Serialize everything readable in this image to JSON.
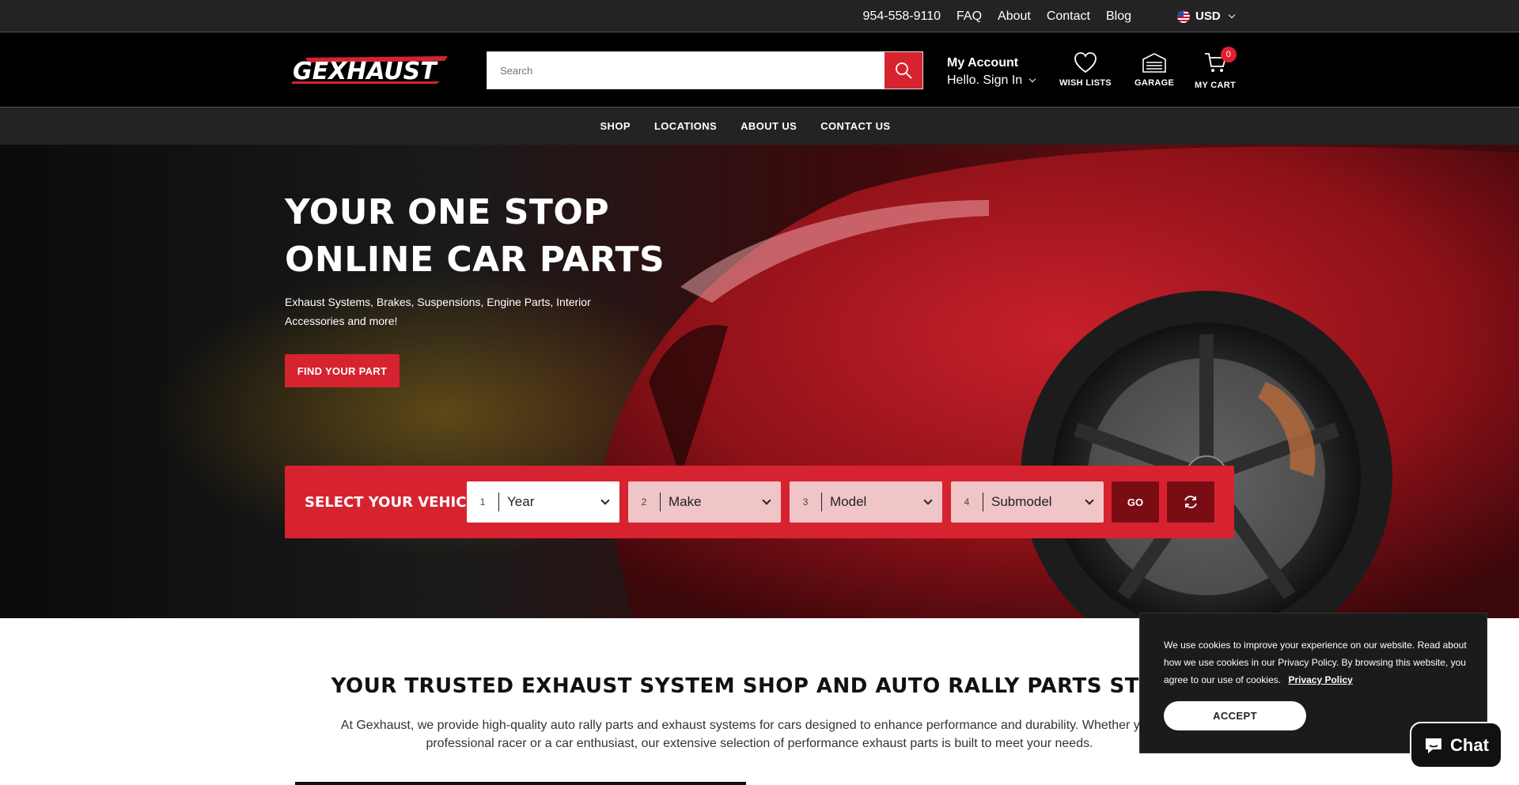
{
  "topbar": {
    "links": [
      "954-558-9110",
      "FAQ",
      "About",
      "Contact",
      "Blog"
    ],
    "currency": "USD"
  },
  "header": {
    "logo_text": "GEXHAUST",
    "search_placeholder": "Search",
    "account_title": "My Account",
    "account_sub": "Hello. Sign In",
    "wishlist_label": "WISH LISTS",
    "garage_label": "GARAGE",
    "cart_label": "MY CART",
    "cart_count": "0"
  },
  "nav": {
    "items": [
      "SHOP",
      "LOCATIONS",
      "ABOUT US",
      "CONTACT US"
    ]
  },
  "hero": {
    "title_line1": "YOUR ONE STOP",
    "title_line2": "ONLINE CAR PARTS",
    "subtitle": "Exhaust Systems, Brakes, Suspensions, Engine Parts, Interior Accessories and more!",
    "cta": "FIND YOUR PART"
  },
  "vehicle": {
    "title": "SELECT YOUR VEHICLE",
    "selects": [
      {
        "num": "1",
        "label": "Year"
      },
      {
        "num": "2",
        "label": "Make"
      },
      {
        "num": "3",
        "label": "Model"
      },
      {
        "num": "4",
        "label": "Submodel"
      }
    ],
    "go_label": "GO"
  },
  "intro": {
    "title": "YOUR TRUSTED EXHAUST SYSTEM SHOP AND AUTO RALLY PARTS STORE",
    "text": "At Gexhaust, we provide high-quality auto rally parts and exhaust systems for cars designed to enhance performance and durability. Whether you're a professional racer or a car enthusiast, our extensive selection of performance exhaust parts is built to meet your needs."
  },
  "cookie": {
    "text": "We use cookies to improve your experience on our website. Read about how we use cookies in our Privacy Policy. By browsing this website, you agree to our use of cookies.",
    "link": "Privacy Policy",
    "accept": "ACCEPT"
  },
  "chat": {
    "label": "Chat"
  },
  "colors": {
    "brand_red": "#d7232f",
    "dark_red": "#7a0d14",
    "topbar_bg": "#232323",
    "header_bg": "#000000"
  }
}
